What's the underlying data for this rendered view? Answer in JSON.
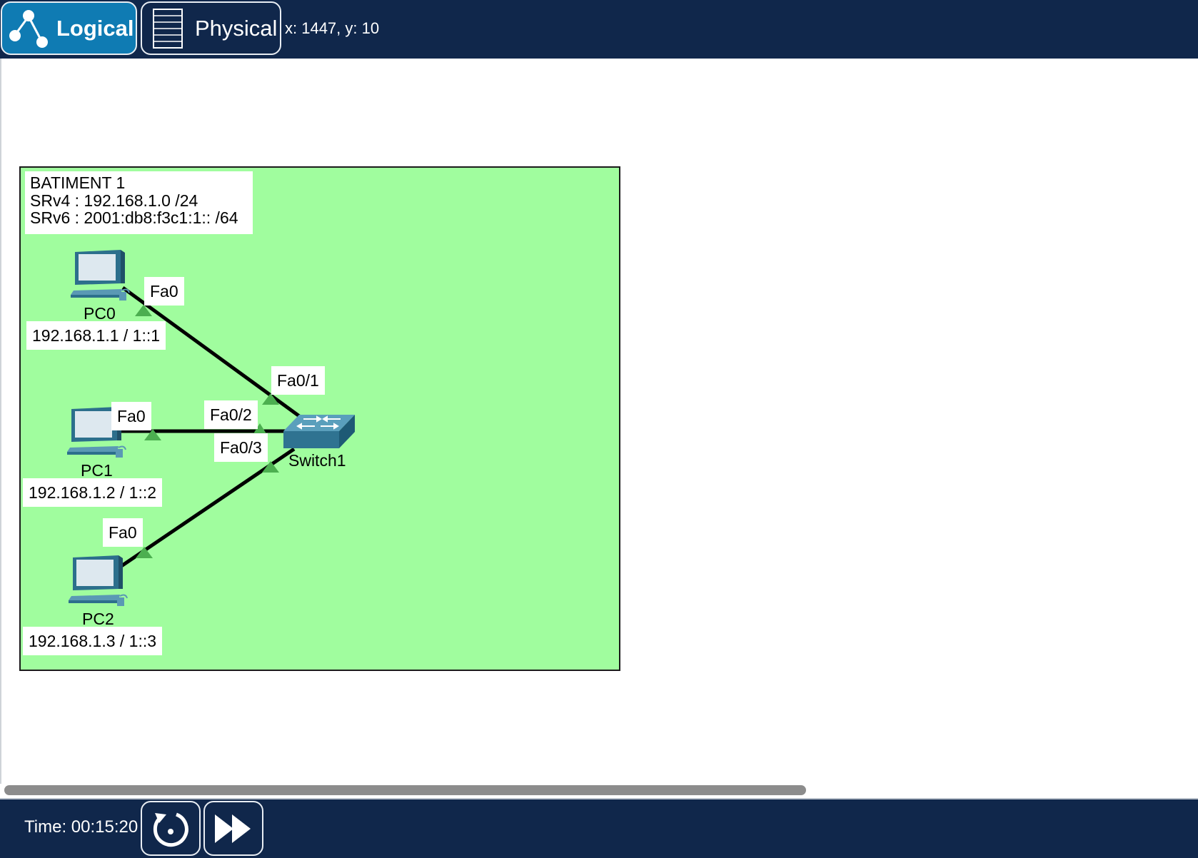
{
  "toolbar": {
    "logical_label": "Logical",
    "physical_label": "Physical",
    "coords": "x: 1447, y: 10"
  },
  "cluster": {
    "note_lines": [
      "BATIMENT 1",
      "SRv4 :  192.168.1.0 /24",
      "SRv6 : 2001:db8:f3c1:1:: /64"
    ]
  },
  "devices": {
    "pc0": {
      "name": "PC0",
      "ip": "192.168.1.1 / 1::1",
      "port": "Fa0"
    },
    "pc1": {
      "name": "PC1",
      "ip": "192.168.1.2 / 1::2",
      "port": "Fa0"
    },
    "pc2": {
      "name": "PC2",
      "ip": "192.168.1.3 / 1::3",
      "port": "Fa0"
    },
    "switch1": {
      "name": "Switch1",
      "ports": [
        "Fa0/1",
        "Fa0/2",
        "Fa0/3"
      ]
    }
  },
  "colors": {
    "toolbar_bg": "#10274b",
    "active_tab": "#0f7bb3",
    "cluster_bg": "#a0fd9e",
    "link_up": "#4caf50"
  },
  "footer": {
    "time": "Time: 00:15:20"
  }
}
